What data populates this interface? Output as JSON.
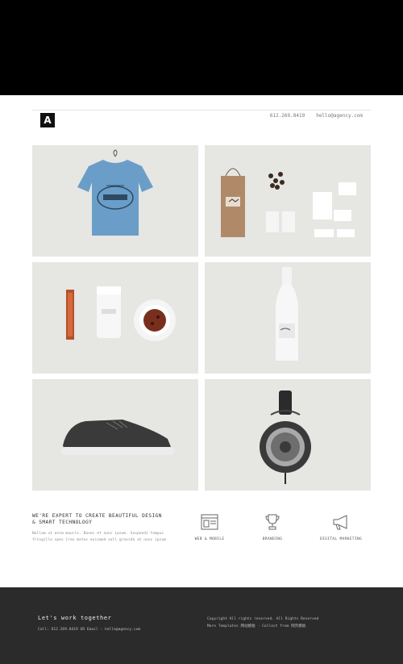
{
  "header": {
    "logo_letter": "A",
    "phone": "612.269.8419",
    "email": "hello@agency.com"
  },
  "grid": {
    "items": [
      {
        "name": "tshirt"
      },
      {
        "name": "stationery"
      },
      {
        "name": "coffee"
      },
      {
        "name": "bottle"
      },
      {
        "name": "sneaker"
      },
      {
        "name": "headphones"
      }
    ]
  },
  "services": {
    "headline_line1": "WE'RE EXPERT TO CREATE BEAUTIFUL DESIGN",
    "headline_line2": "& SMART TECHNOLOGY",
    "blurb": "Nullam ut enim mauris. Donec et nunc ipsum. Suspendi tempus fringilla spes Cras metus euismod voll gravida at nunc ipsum",
    "items": [
      {
        "label": "WEB & MOBILE",
        "icon": "browser-window-icon"
      },
      {
        "label": "BRANDING",
        "icon": "trophy-icon"
      },
      {
        "label": "DIGITAL MARKETING",
        "icon": "megaphone-icon"
      }
    ]
  },
  "footer": {
    "title": "Let's work together",
    "call": "Call: 612.269.8419 OR Email : hello@agency.com",
    "copyright_line1": "Copyright All rights reserved. All Rights Reserved",
    "copyright_line2": "More Templates 网站模板 - Collect from 网页模板"
  }
}
